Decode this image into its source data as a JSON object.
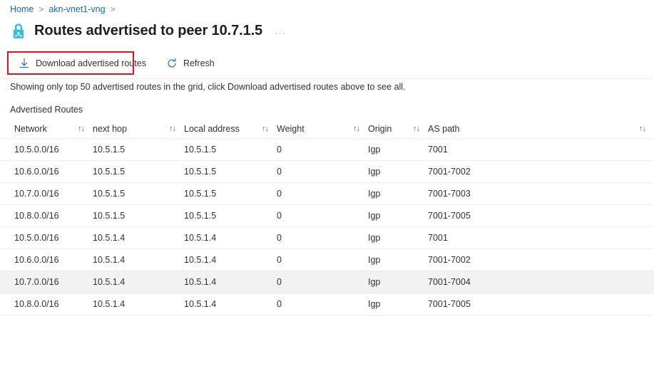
{
  "breadcrumb": {
    "items": [
      {
        "label": "Home"
      },
      {
        "label": "akn-vnet1-vng"
      }
    ],
    "separator": ">"
  },
  "header": {
    "icon": "vpn-gateway-lock-icon",
    "title": "Routes advertised to peer 10.7.1.5",
    "more_label": "..."
  },
  "toolbar": {
    "download_label": "Download advertised routes",
    "download_icon": "download-arrow-icon",
    "refresh_label": "Refresh",
    "refresh_icon": "refresh-circular-arrow-icon",
    "highlight_color": "#e81123"
  },
  "info": {
    "message": "Showing only top 50 advertised routes in the grid, click Download advertised routes above to see all."
  },
  "grid": {
    "label": "Advertised Routes",
    "sort_icon": "↑↓",
    "columns": [
      {
        "key": "network",
        "label": "Network",
        "sortable": true
      },
      {
        "key": "next_hop",
        "label": "next hop",
        "sortable": true
      },
      {
        "key": "local_address",
        "label": "Local address",
        "sortable": true
      },
      {
        "key": "weight",
        "label": "Weight",
        "sortable": true
      },
      {
        "key": "origin",
        "label": "Origin",
        "sortable": true
      },
      {
        "key": "as_path",
        "label": "AS path",
        "sortable": true
      }
    ],
    "rows": [
      {
        "network": "10.5.0.0/16",
        "next_hop": "10.5.1.5",
        "local_address": "10.5.1.5",
        "weight": "0",
        "origin": "Igp",
        "as_path": "7001",
        "selected": false
      },
      {
        "network": "10.6.0.0/16",
        "next_hop": "10.5.1.5",
        "local_address": "10.5.1.5",
        "weight": "0",
        "origin": "Igp",
        "as_path": "7001-7002",
        "selected": false
      },
      {
        "network": "10.7.0.0/16",
        "next_hop": "10.5.1.5",
        "local_address": "10.5.1.5",
        "weight": "0",
        "origin": "Igp",
        "as_path": "7001-7003",
        "selected": false
      },
      {
        "network": "10.8.0.0/16",
        "next_hop": "10.5.1.5",
        "local_address": "10.5.1.5",
        "weight": "0",
        "origin": "Igp",
        "as_path": "7001-7005",
        "selected": false
      },
      {
        "network": "10.5.0.0/16",
        "next_hop": "10.5.1.4",
        "local_address": "10.5.1.4",
        "weight": "0",
        "origin": "Igp",
        "as_path": "7001",
        "selected": false
      },
      {
        "network": "10.6.0.0/16",
        "next_hop": "10.5.1.4",
        "local_address": "10.5.1.4",
        "weight": "0",
        "origin": "Igp",
        "as_path": "7001-7002",
        "selected": false
      },
      {
        "network": "10.7.0.0/16",
        "next_hop": "10.5.1.4",
        "local_address": "10.5.1.4",
        "weight": "0",
        "origin": "Igp",
        "as_path": "7001-7004",
        "selected": true
      },
      {
        "network": "10.8.0.0/16",
        "next_hop": "10.5.1.4",
        "local_address": "10.5.1.4",
        "weight": "0",
        "origin": "Igp",
        "as_path": "7001-7005",
        "selected": false
      }
    ]
  },
  "colors": {
    "link": "#0f6cbd",
    "text": "#323130",
    "border": "#edebe9",
    "row_selected": "#f3f2f1",
    "icon_accent": "#32bedd"
  }
}
